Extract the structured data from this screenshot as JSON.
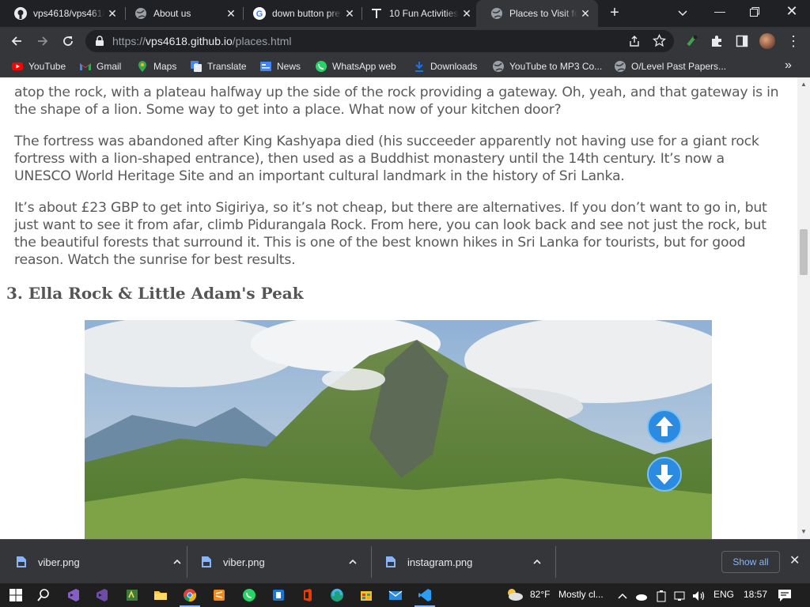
{
  "tabs": [
    {
      "title": "vps4618/vps4618",
      "icon": "github-icon",
      "active": false
    },
    {
      "title": "About us",
      "icon": "globe-icon",
      "active": false
    },
    {
      "title": "down button pre",
      "icon": "google-icon",
      "active": false
    },
    {
      "title": "10 Fun Activities",
      "icon": "site-icon",
      "active": false
    },
    {
      "title": "Places to Visit fo",
      "icon": "globe-icon",
      "active": true
    }
  ],
  "toolbar": {
    "url_prefix": "https://",
    "url_host": "vps4618.github.io",
    "url_path": "/places.html"
  },
  "bookmarks": [
    {
      "label": "YouTube",
      "icon": "youtube-icon"
    },
    {
      "label": "Gmail",
      "icon": "gmail-icon"
    },
    {
      "label": "Maps",
      "icon": "maps-icon"
    },
    {
      "label": "Translate",
      "icon": "translate-icon"
    },
    {
      "label": "News",
      "icon": "news-icon"
    },
    {
      "label": "WhatsApp web",
      "icon": "whatsapp-icon"
    },
    {
      "label": "Downloads",
      "icon": "download-icon"
    },
    {
      "label": "YouTube to MP3 Co...",
      "icon": "globe-icon"
    },
    {
      "label": "O/Level Past Papers...",
      "icon": "globe-icon"
    }
  ],
  "page": {
    "para1_tail": "atop the rock, with a plateau halfway up the side of the rock providing a gateway. Oh, yeah, and that gateway is in the shape of a lion. Some way to get into a place. What now of your kitchen door?",
    "para2": "The fortress was abandoned after King Kashyapa died (his succeeder apparently not having use for a giant rock fortress with a lion-shaped entrance), then used as a Buddhist monastery until the 14th century. It’s now a UNESCO World Heritage Site and an important cultural landmark in the history of Sri Lanka.",
    "para3": "It’s about £23 GBP to get into Sigiriya, so it’s not cheap, but there are alternatives. If you don’t want to go in, but just want to see it from afar, climb Pidurangala Rock. From here, you can look back and see not just the rock, but the beautiful forests that surround it. This is one of the best known hikes in Sri Lanka for tourists, but for good reason. Watch the sunrise for best results.",
    "heading": "3. Ella Rock & Little Adam's Peak"
  },
  "downloads": {
    "items": [
      {
        "name": "viber.png"
      },
      {
        "name": "viber.png"
      },
      {
        "name": "instagram.png"
      }
    ],
    "show_all": "Show all"
  },
  "taskbar": {
    "temperature": "82°F",
    "weather": "Mostly cl...",
    "language": "ENG",
    "time": "18:57"
  },
  "colors": {
    "accent": "#8ab4f8",
    "page_text": "#5a5a5a",
    "scroll_button": "#2a8be0"
  }
}
